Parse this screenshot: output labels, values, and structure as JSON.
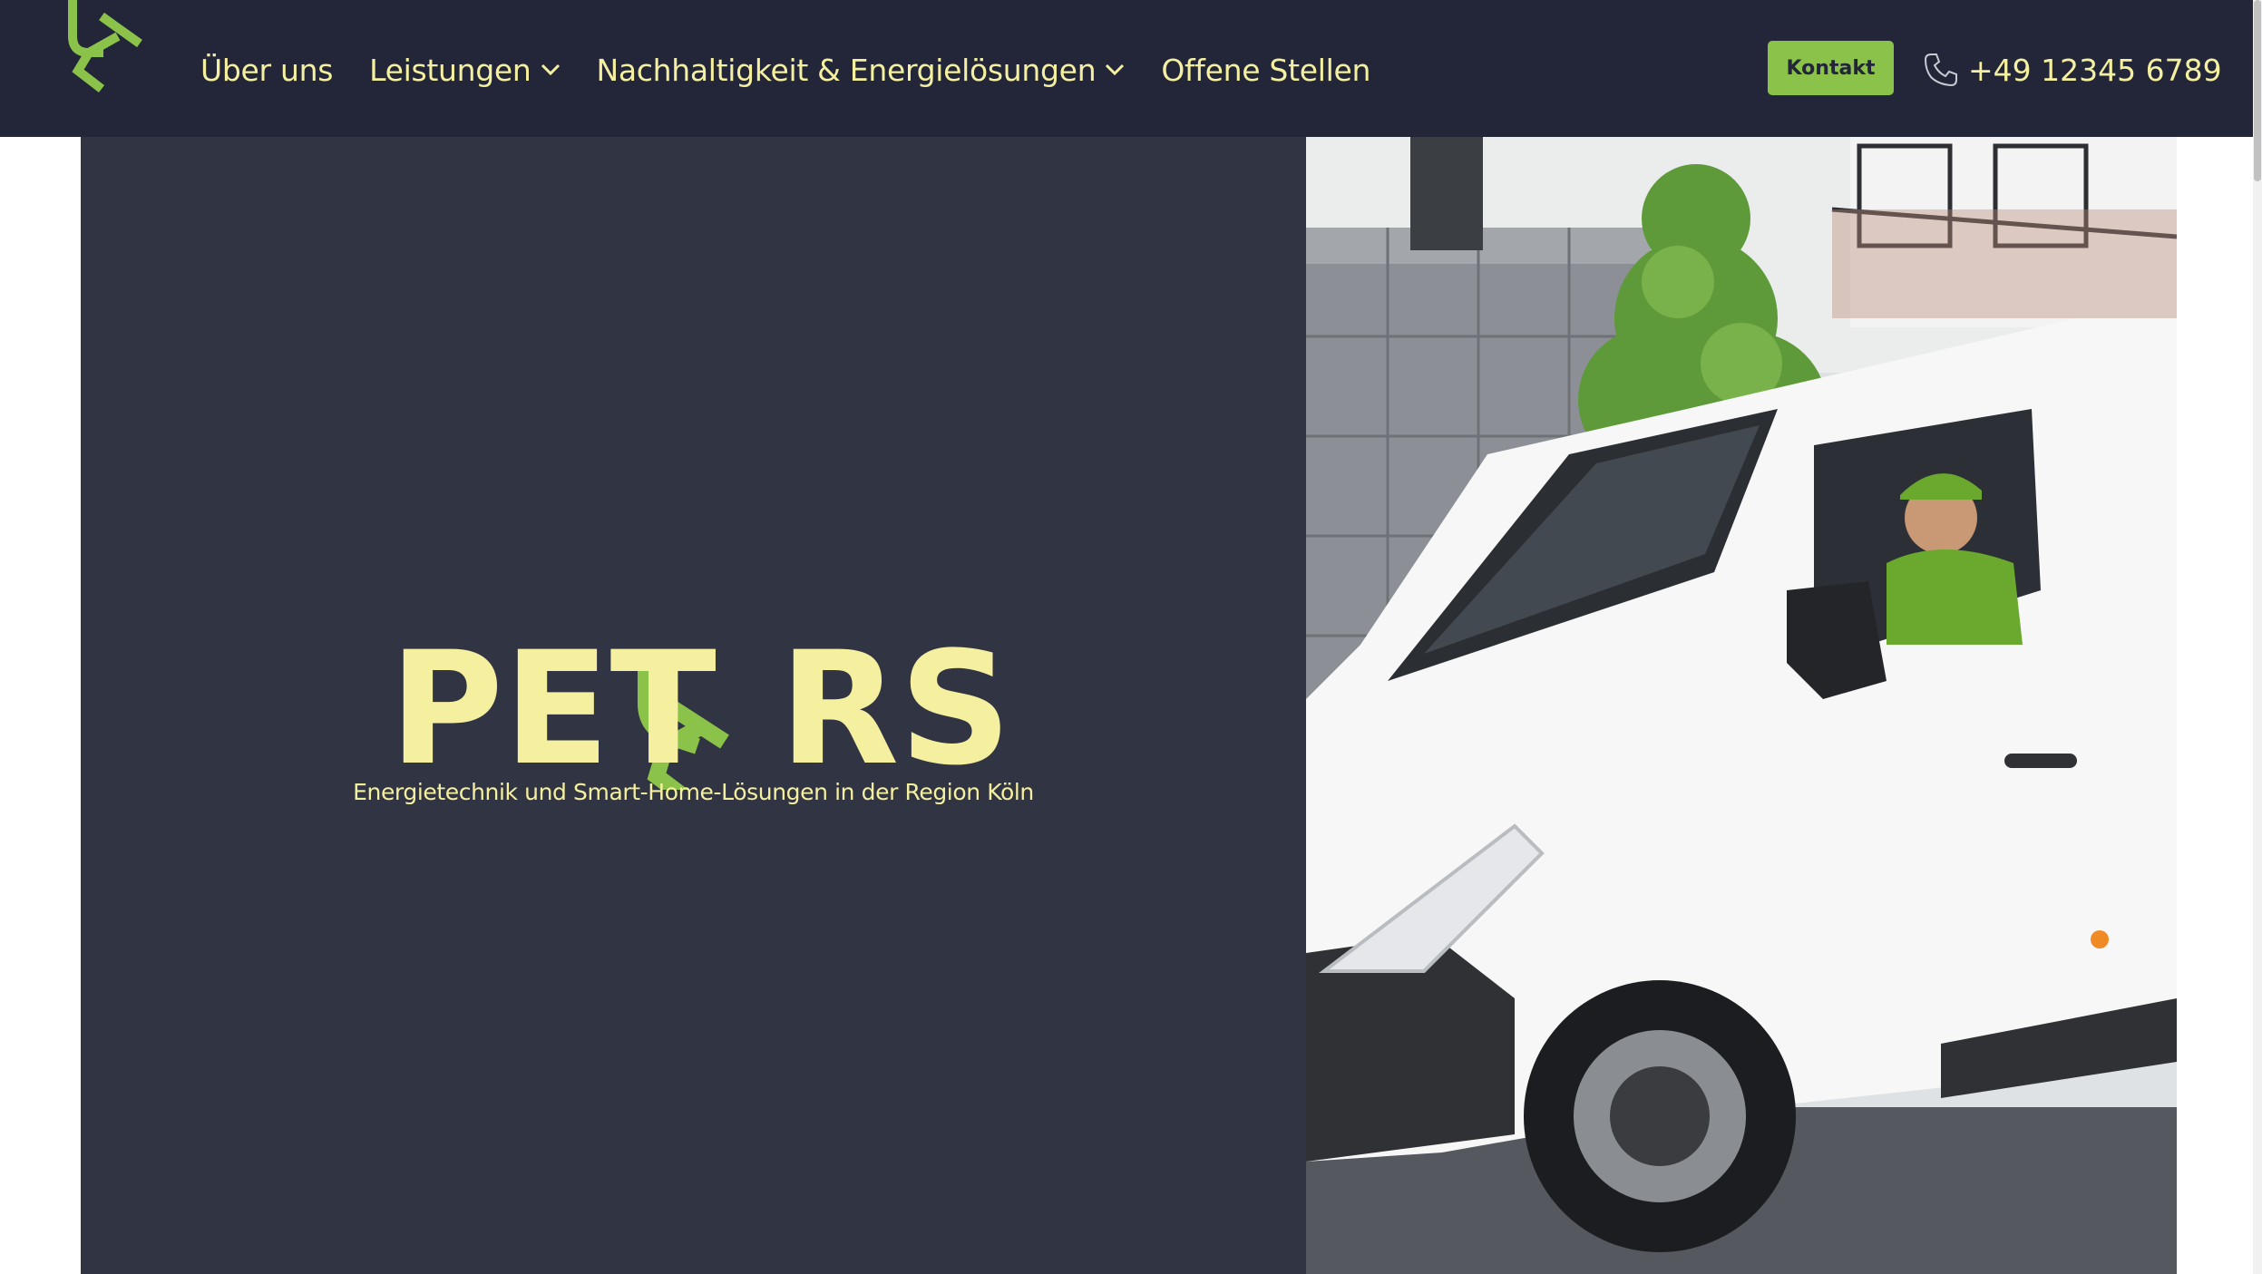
{
  "header": {
    "nav": [
      {
        "label": "Über uns",
        "has_dropdown": false
      },
      {
        "label": "Leistungen",
        "has_dropdown": true
      },
      {
        "label": "Nachhaltigkeit & Energielösungen",
        "has_dropdown": true
      },
      {
        "label": "Offene Stellen",
        "has_dropdown": false
      }
    ],
    "contact_button": "Kontakt",
    "phone": "+49 12345 6789"
  },
  "hero": {
    "brand_left": "PET",
    "brand_right": "RS",
    "tagline": "Energietechnik und Smart-Home-Lösungen in der Region Köln"
  },
  "colors": {
    "header_bg": "#222638",
    "hero_bg": "#313442",
    "accent_green": "#8bc34a",
    "text_yellow": "#f5f0a0"
  },
  "icons": {
    "logo": "peters-e-logo",
    "dropdown": "chevron-down-icon",
    "phone": "phone-icon"
  }
}
